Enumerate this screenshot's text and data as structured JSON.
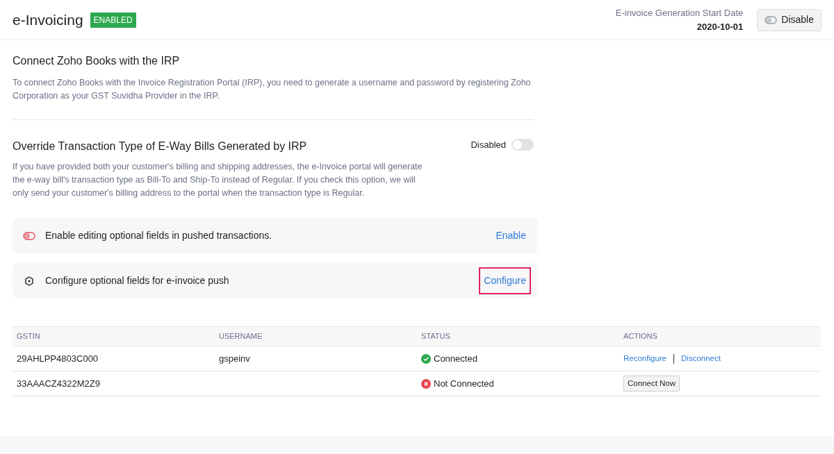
{
  "header": {
    "title": "e-Invoicing",
    "badge": "ENABLED",
    "start_date_label": "E-invoice Generation Start Date",
    "start_date": "2020-10-01",
    "disable_button": "Disable"
  },
  "connect": {
    "title": "Connect Zoho Books with the IRP",
    "description": "To connect Zoho Books with the Invoice Registration Portal (IRP), you need to generate a username and password by registering Zoho Corporation as your GST Suvidha Provider in the IRP."
  },
  "override": {
    "title": "Override Transaction Type of E-Way Bills Generated by IRP",
    "toggle_label": "Disabled",
    "on": false,
    "description": "If you have provided both your customer's billing and shipping addresses, the e-Invoice portal will generate the e-way bill's transaction type as Bill-To and Ship-To instead of Regular. If you check this option, we will only send your customer's billing address to the portal when the transaction type is Regular."
  },
  "options": [
    {
      "kind": "toggle",
      "text": "Enable editing optional fields in pushed transactions.",
      "action": "Enable",
      "highlighted": false
    },
    {
      "kind": "settings",
      "text": "Configure optional fields for e-invoice push",
      "action": "Configure",
      "highlighted": true
    }
  ],
  "table": {
    "columns": [
      "GSTIN",
      "USERNAME",
      "STATUS",
      "ACTIONS"
    ],
    "rows": [
      {
        "gstin": "29AHLPP4803C000",
        "username": "gspeinv",
        "status": "Connected",
        "connected": true,
        "actions": [
          "Reconfigure",
          "Disconnect"
        ]
      },
      {
        "gstin": "33AAACZ4322M2Z9",
        "username": "",
        "status": "Not Connected",
        "connected": false,
        "actions": [
          "Connect Now"
        ]
      }
    ]
  }
}
